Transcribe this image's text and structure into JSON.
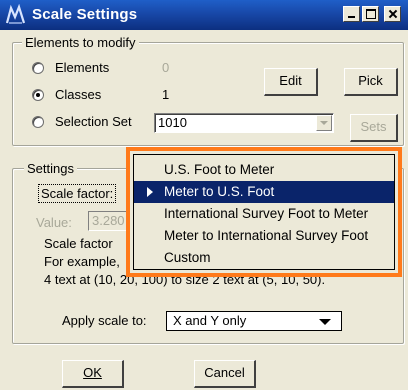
{
  "window": {
    "title": "Scale Settings",
    "icon": "microstation-icon"
  },
  "elements_group": {
    "legend": "Elements to modify",
    "options": [
      {
        "label": "Elements",
        "value": "0",
        "checked": false,
        "value_disabled": true
      },
      {
        "label": "Classes",
        "value": "1",
        "checked": true,
        "value_disabled": false
      },
      {
        "label": "Selection Set",
        "value": "1010",
        "checked": false
      }
    ],
    "edit_label": "Edit",
    "pick_label": "Pick",
    "sets_label": "Sets"
  },
  "settings_group": {
    "legend": "Settings",
    "scale_factor_label": "Scale factor:",
    "value_label": "Value:",
    "value_text": "3.280",
    "description_lines": [
      "Scale factor",
      "For example,",
      "4 text at (10, 20, 100) to size 2 text at (5, 10, 50)."
    ],
    "apply_label": "Apply scale to:",
    "apply_value": "X and Y only"
  },
  "dropdown": {
    "items": [
      "U.S. Foot to Meter",
      "Meter to U.S. Foot",
      "International Survey Foot to Meter",
      "Meter to International Survey Foot",
      "Custom"
    ],
    "selected_index": 1,
    "highlight_color": "#ff7a1a"
  },
  "buttons": {
    "ok_label": "OK",
    "cancel_label": "Cancel"
  }
}
